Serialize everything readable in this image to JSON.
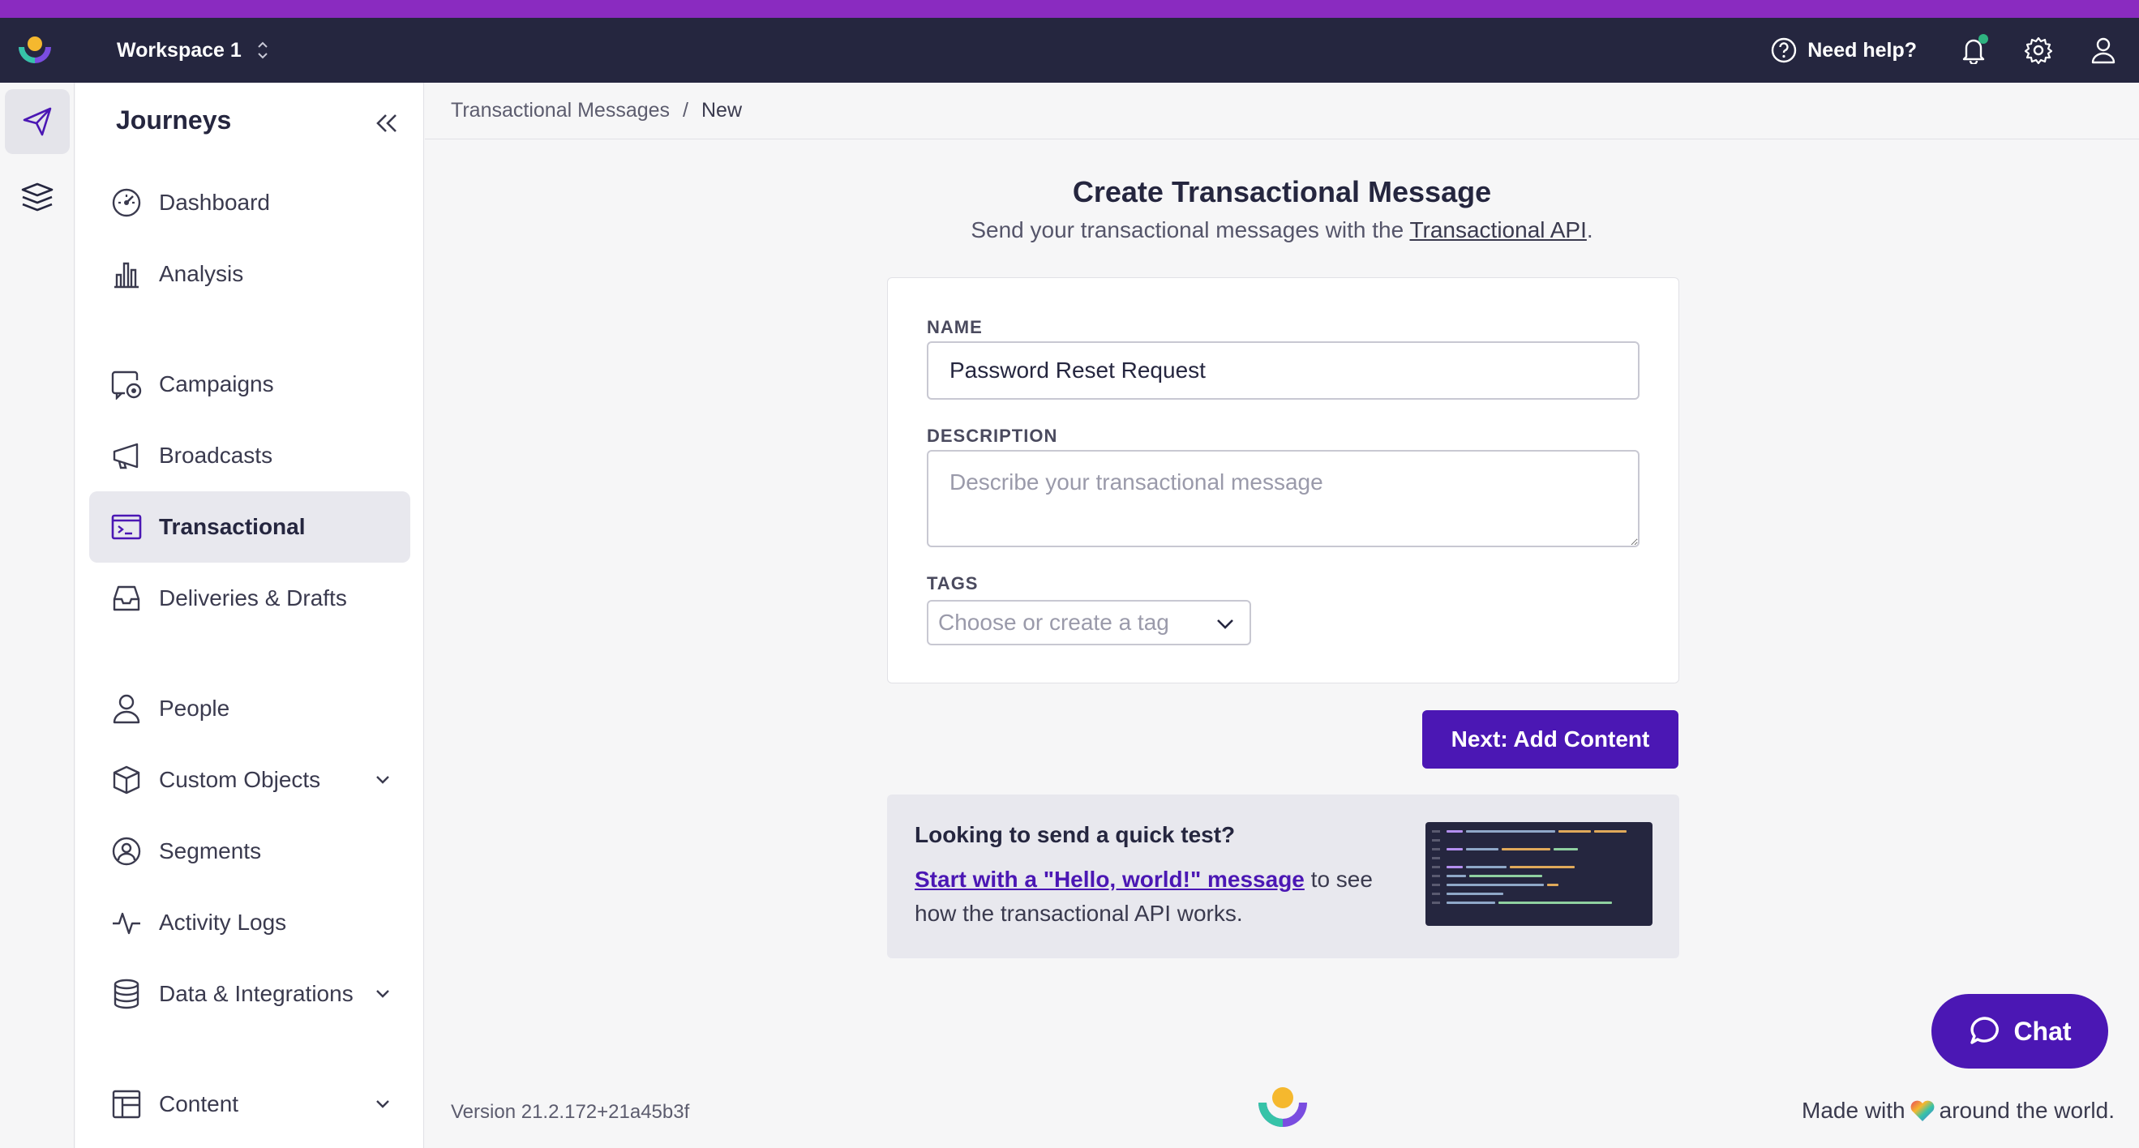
{
  "colors": {
    "brand_stripe": "#8a2bc0",
    "topbar": "#25263f",
    "primary": "#4b17b4",
    "status_dot": "#2fb380"
  },
  "topbar": {
    "workspace": "Workspace 1",
    "help_label": "Need help?",
    "icons": [
      "brand-logo",
      "chevron-updown-icon",
      "help-circle-icon",
      "bell-icon",
      "gear-icon",
      "user-icon"
    ]
  },
  "rail": {
    "icons": [
      "paper-plane-icon",
      "layers-icon"
    ]
  },
  "sidebar": {
    "title": "Journeys",
    "items": [
      {
        "label": "Dashboard",
        "icon": "gauge-icon"
      },
      {
        "label": "Analysis",
        "icon": "bar-chart-icon"
      },
      {
        "label": "Campaigns",
        "icon": "campaign-icon"
      },
      {
        "label": "Broadcasts",
        "icon": "megaphone-icon"
      },
      {
        "label": "Transactional",
        "icon": "terminal-icon",
        "active": true
      },
      {
        "label": "Deliveries & Drafts",
        "icon": "inbox-icon"
      },
      {
        "label": "People",
        "icon": "person-icon"
      },
      {
        "label": "Custom Objects",
        "icon": "cube-icon",
        "expandable": true
      },
      {
        "label": "Segments",
        "icon": "segment-icon"
      },
      {
        "label": "Activity Logs",
        "icon": "pulse-icon"
      },
      {
        "label": "Data & Integrations",
        "icon": "database-icon",
        "expandable": true
      },
      {
        "label": "Content",
        "icon": "layout-icon",
        "expandable": true
      }
    ]
  },
  "breadcrumb": {
    "parent": "Transactional Messages",
    "separator": "/",
    "current": "New"
  },
  "page": {
    "title": "Create Transactional Message",
    "subtitle_prefix": "Send your transactional messages with the ",
    "subtitle_link": "Transactional API",
    "subtitle_suffix": "."
  },
  "form": {
    "name_label": "NAME",
    "name_value": "Password Reset Request",
    "description_label": "DESCRIPTION",
    "description_value": "",
    "description_placeholder": "Describe your transactional message",
    "tags_label": "TAGS",
    "tags_placeholder": "Choose or create a tag"
  },
  "next_button": "Next: Add Content",
  "tip": {
    "title": "Looking to send a quick test?",
    "link": "Start with a \"Hello, world!\" message",
    "text_after": " to see how the transactional API works."
  },
  "chat_label": "Chat",
  "footer": {
    "version": "Version 21.2.172+21a45b3f",
    "made_prefix": "Made with",
    "made_suffix": "around the world."
  }
}
